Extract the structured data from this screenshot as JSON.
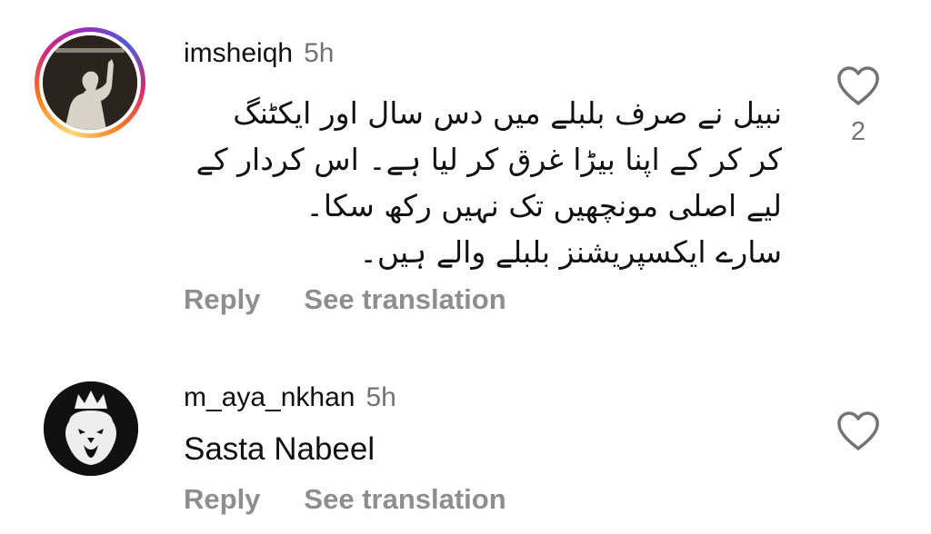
{
  "comments": [
    {
      "username": "imsheiqh",
      "time": "5h",
      "text_lines": [
        "نبیل نے صرف بلبلے میں دس سال اور ایکٹنگ",
        "کر کر کے اپنا بیڑا غرق کر لیا ہے۔ اس کردار کے",
        "لیے اصلی مونچھیں تک نہیں رکھ سکا۔",
        "سارے ایکسپریشنز بلبلے والے ہیں۔"
      ],
      "reply_label": "Reply",
      "translate_label": "See translation",
      "like_count": "2",
      "avatar_icon": "silhouette-avatar-icon"
    },
    {
      "username": "m_aya_nkhan",
      "time": "5h",
      "text": "Sasta Nabeel",
      "reply_label": "Reply",
      "translate_label": "See translation",
      "avatar_icon": "lion-crown-avatar-icon"
    }
  ],
  "colors": {
    "text": "#111111",
    "muted": "#737373",
    "action": "#8e8e8e",
    "avatar_dark": "#1a1a1a"
  }
}
